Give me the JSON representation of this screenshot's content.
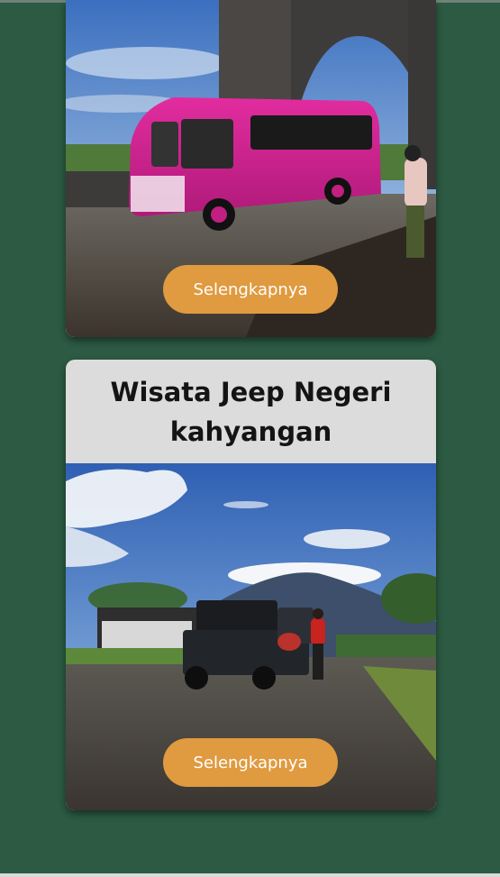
{
  "cards": [
    {
      "title": "",
      "button_label": "Selengkapnya"
    },
    {
      "title": "Wisata Jeep Negeri kahyangan",
      "button_label": "Selengkapnya"
    }
  ]
}
